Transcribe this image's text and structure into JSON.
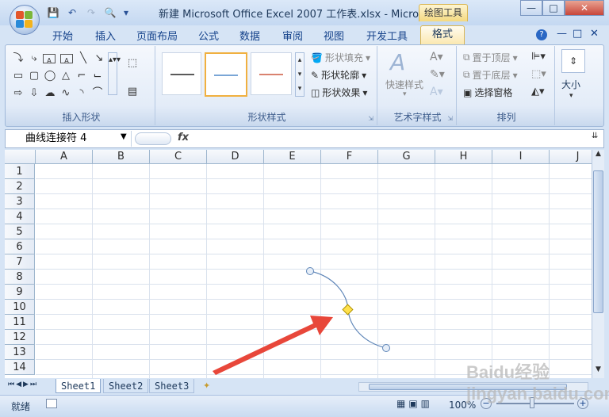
{
  "title": "新建 Microsoft Office Excel 2007 工作表.xlsx - Micro...",
  "contextual_tab": "绘图工具",
  "window_buttons": [
    "—",
    "□",
    "✕"
  ],
  "ribbon_tabs": [
    "开始",
    "插入",
    "页面布局",
    "公式",
    "数据",
    "审阅",
    "视图",
    "开发工具",
    "格式"
  ],
  "ribbon_right_icons": [
    "?",
    "—",
    "□",
    "✕"
  ],
  "groups": {
    "insert_shapes": {
      "label": "插入形状"
    },
    "shape_styles": {
      "label": "形状样式",
      "fill": "形状填充",
      "outline": "形状轮廓",
      "effects": "形状效果",
      "style_colors": [
        "#5a5a5a",
        "#7aa6d6",
        "#d9826f"
      ]
    },
    "wordart": {
      "label": "艺术字样式",
      "quick": "快速样式"
    },
    "arrange": {
      "label": "排列",
      "front": "置于顶层",
      "back": "置于底层",
      "pane": "选择窗格"
    },
    "size": {
      "label": "大小"
    }
  },
  "name_box": "曲线连接符 4",
  "fx_label": "fx",
  "formula_value": "",
  "columns": [
    "A",
    "B",
    "C",
    "D",
    "E",
    "F",
    "G",
    "H",
    "I",
    "J"
  ],
  "rows": [
    "1",
    "2",
    "3",
    "4",
    "5",
    "6",
    "7",
    "8",
    "9",
    "10",
    "11",
    "12",
    "13",
    "14"
  ],
  "sheets": [
    "Sheet1",
    "Sheet2",
    "Sheet3"
  ],
  "status": {
    "ready": "就绪",
    "zoom": "100%"
  },
  "watermark": "Baidu经验 jingyan.baidu.com",
  "colors": {
    "connector": "#5f86b8",
    "arrow": "#e8473a",
    "accent": "#fbe8b0"
  }
}
